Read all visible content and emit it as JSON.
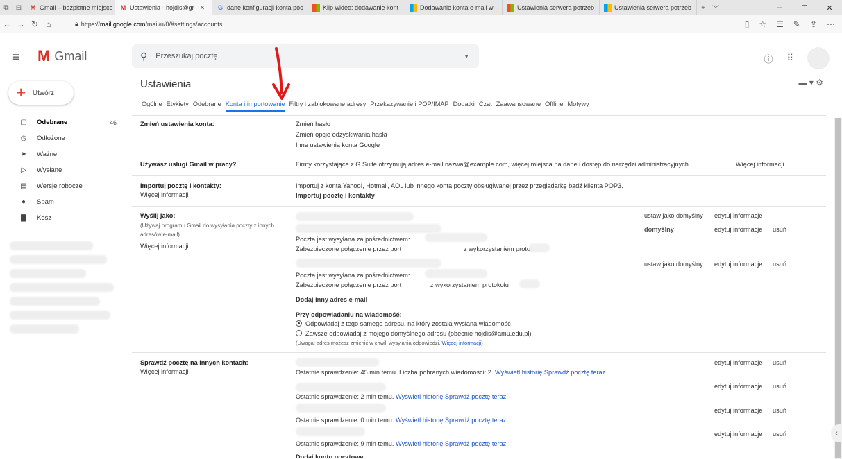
{
  "browser": {
    "tabs": [
      {
        "label": "Gmail – bezpłatne miejsce r",
        "favicon": "M",
        "icon": "gmail-icon"
      },
      {
        "label": "Ustawienia - hojdis@gr",
        "favicon": "M",
        "icon": "gmail-icon",
        "active": true
      },
      {
        "label": "dane konfiguracji konta poc",
        "favicon": "G",
        "icon": "google-icon"
      },
      {
        "label": "Klip wideo: dodawanie kont",
        "favicon": "",
        "icon": "office-icon"
      },
      {
        "label": "Dodawanie konta e-mail w",
        "favicon": "",
        "icon": "office-icon"
      },
      {
        "label": "Ustawienia serwera potrzeb",
        "favicon": "",
        "icon": "office-icon"
      },
      {
        "label": "Ustawienia serwera potrzeb",
        "favicon": "",
        "icon": "office-icon"
      }
    ],
    "url_prefix": "https://",
    "url_host": "mail.google.com",
    "url_path": "/mail/u/0/#settings/accounts"
  },
  "gmail": {
    "brand": "Gmail",
    "search_placeholder": "Przeszukaj pocztę",
    "compose": "Utwórz"
  },
  "sidebar": {
    "items": [
      {
        "label": "Odebrane",
        "count": "46",
        "icon": "inbox-icon"
      },
      {
        "label": "Odłożone",
        "count": "",
        "icon": "clock-icon"
      },
      {
        "label": "Ważne",
        "count": "",
        "icon": "important-icon"
      },
      {
        "label": "Wysłane",
        "count": "",
        "icon": "send-icon"
      },
      {
        "label": "Wersje robocze",
        "count": "",
        "icon": "draft-icon"
      },
      {
        "label": "Spam",
        "count": "",
        "icon": "spam-icon"
      },
      {
        "label": "Kosz",
        "count": "",
        "icon": "trash-icon"
      }
    ]
  },
  "settings": {
    "title": "Ustawienia",
    "tabs": [
      "Ogólne",
      "Etykiety",
      "Odebrane",
      "Konta i importowanie",
      "Filtry i zablokowane adresy",
      "Przekazywanie i POP/IMAP",
      "Dodatki",
      "Czat",
      "Zaawansowane",
      "Offline",
      "Motywy"
    ],
    "change_account": {
      "label": "Zmień ustawienia konta:",
      "links": [
        "Zmień hasło",
        "Zmień opcje odzyskiwania hasła",
        "Inne ustawienia konta Google"
      ]
    },
    "gsuite": {
      "label": "Używasz usługi Gmail w pracy?",
      "text": "Firmy korzystające z G Suite otrzymują adres e-mail nazwa@example.com, więcej miejsca na dane i dostęp do narzędzi administracyjnych.",
      "link": "Więcej informacji"
    },
    "import": {
      "label": "Importuj pocztę i kontakty:",
      "more": "Więcej informacji",
      "text": "Importuj z konta Yahoo!, Hotmail, AOL lub innego konta poczty obsługiwanej przez przeglądarkę bądź klienta POP3.",
      "action": "Importuj pocztę i kontakty"
    },
    "send_as": {
      "label": "Wyślij jako:",
      "sub": "(Używaj programu Gmail do wysyłania poczty z innych adresów e-mail)",
      "more": "Więcej informacji",
      "sent_via": "Poczta jest wysyłana za pośrednictwem:",
      "secure_port": "Zabezpieczone połączenie przez port",
      "protocol": "z wykorzystaniem protokołu",
      "set_default": "ustaw jako domyślny",
      "edit": "edytuj informacje",
      "default": "domyślny",
      "delete": "usuń",
      "add_other": "Dodaj inny adres e-mail",
      "reply_label": "Przy odpowiadaniu na wiadomość:",
      "reply_opt1": "Odpowiadaj z tego samego adresu, na który została wysłana wiadomość",
      "reply_opt2": "Zawsze odpowiadaj z mojego domyślnego adresu (obecnie hojdis@amu.edu.pl)",
      "note": "(Uwaga: adres możesz zmienić w chwili wysyłania odpowiedzi.",
      "note_link": "Więcej informacji",
      "note_close": ")"
    },
    "check_mail": {
      "label": "Sprawdź pocztę na innych kontach:",
      "more": "Więcej informacji",
      "edit": "edytuj informacje",
      "delete": "usuń",
      "rows": [
        {
          "status": "Ostatnie sprawdzenie: 45 min temu. Liczba pobranych wiadomości: 2."
        },
        {
          "status": "Ostatnie sprawdzenie: 2 min temu."
        },
        {
          "status": "Ostatnie sprawdzenie: 0 min temu."
        },
        {
          "status": "Ostatnie sprawdzenie: 9 min temu."
        }
      ],
      "history": "Wyświetl historię",
      "check_now": "Sprawdź pocztę teraz",
      "add": "Dodaj konto pocztowe"
    }
  },
  "colors": {
    "accent": "#1a73e8",
    "link": "#1a57c9",
    "arrow": "#e0191b",
    "gmail_red": "#d93025"
  }
}
